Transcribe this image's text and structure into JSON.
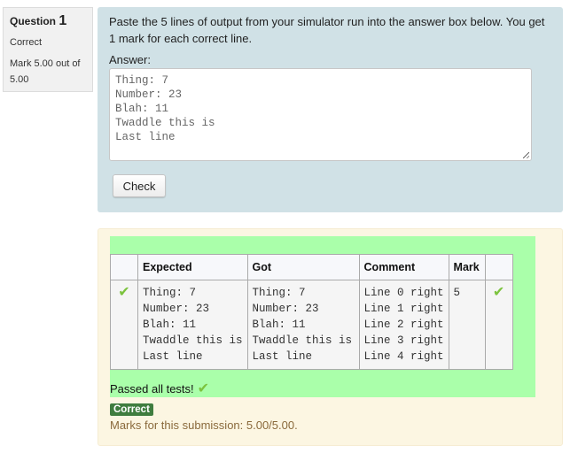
{
  "info": {
    "question_label": "Question",
    "question_number": "1",
    "state": "Correct",
    "grade": "Mark 5.00 out of 5.00"
  },
  "question": {
    "text": "Paste the 5 lines of output from your simulator run into the answer box below. You get 1 mark for each correct line.",
    "answer_label": "Answer:",
    "answer_value": "Thing: 7\nNumber: 23\nBlah: 11\nTwaddle this is\nLast line",
    "check_label": "Check"
  },
  "results": {
    "columns": [
      "",
      "Expected",
      "Got",
      "Comment",
      "Mark",
      ""
    ],
    "rows": [
      {
        "status_icon": "tick-icon",
        "expected": "Thing: 7\nNumber: 23\nBlah: 11\nTwaddle this is\nLast line",
        "got": "Thing: 7\nNumber: 23\nBlah: 11\nTwaddle this is\nLast line",
        "comment": "Line 0 right\nLine 1 right\nLine 2 right\nLine 3 right\nLine 4 right",
        "mark": "5",
        "result_icon": "tick-icon"
      }
    ],
    "summary": "Passed all tests!",
    "tick_glyph": "✔",
    "pass_color": "#aaffaa"
  },
  "feedback": {
    "badge": "Correct",
    "badge_color": "#3f7d3f",
    "marks_text": "Marks for this submission: 5.00/5.00."
  }
}
